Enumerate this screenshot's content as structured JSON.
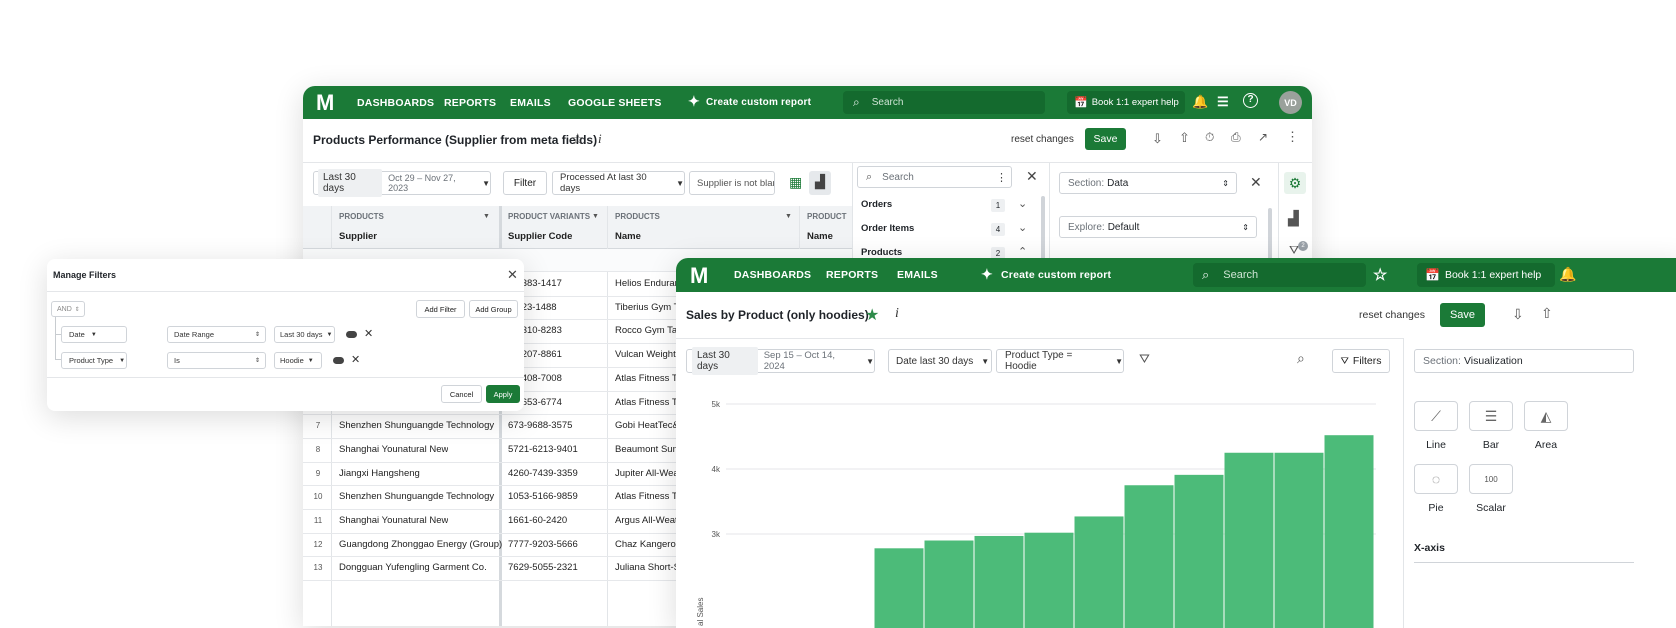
{
  "nav": {
    "dashboards": "DASHBOARDS",
    "reports": "REPORTS",
    "emails": "EMAILS",
    "google_sheets": "GOOGLE SHEETS",
    "create_custom_report": "Create custom report",
    "search_placeholder": "Search",
    "book_help": "Book 1:1 expert help",
    "avatar_initials": "VD"
  },
  "back": {
    "title": "Products Performance (Supplier from meta fields)",
    "reset": "reset changes",
    "save": "Save",
    "date_chip_label": "Last 30 days",
    "date_chip_range": "Oct 29 – Nov 27, 2023",
    "filter_btn": "Filter",
    "processed_chip": "Processed At last 30 days",
    "supplier_chip": "Supplier is not blan",
    "col_groups": [
      "PRODUCTS",
      "PRODUCT VARIANTS",
      "PRODUCTS",
      "PRODUCT"
    ],
    "col_headers": [
      "Supplier",
      "Supplier Code",
      "Name",
      "Name"
    ],
    "rows": [
      {
        "num": "",
        "supplier": "",
        "code": "1-8383-1417",
        "name": "Helios Enduran"
      },
      {
        "num": "",
        "supplier": "",
        "code": "7-423-1488",
        "name": "Tiberius Gym Ta"
      },
      {
        "num": "",
        "supplier": "",
        "code": "3-6310-8283",
        "name": "Rocco Gym Tan"
      },
      {
        "num": "",
        "supplier": "",
        "code": "7-4207-8861",
        "name": "Vulcan Weightli"
      },
      {
        "num": "",
        "supplier": "",
        "code": "7-8408-7008",
        "name": "Atlas Fitness Ta"
      },
      {
        "num": "",
        "supplier": "",
        "code": "8-3653-6774",
        "name": "Atlas Fitness Ta"
      },
      {
        "num": "7",
        "supplier": "Shenzhen Shunguangde Technology",
        "code": "673-9688-3575",
        "name": "Gobi HeatTec&"
      },
      {
        "num": "8",
        "supplier": "Shanghai Younatural New",
        "code": "5721-6213-9401",
        "name": "Beaumont Sum"
      },
      {
        "num": "9",
        "supplier": "Jiangxi Hangsheng",
        "code": "4260-7439-3359",
        "name": "Jupiter All-Wea"
      },
      {
        "num": "10",
        "supplier": "Shenzhen Shunguangde Technology",
        "code": "1053-5166-9859",
        "name": "Atlas Fitness Ta"
      },
      {
        "num": "11",
        "supplier": "Shanghai Younatural New",
        "code": "1661-60-2420",
        "name": "Argus All-Weath"
      },
      {
        "num": "12",
        "supplier": "Guangdong Zhonggao Energy (Group)",
        "code": "7777-9203-5666",
        "name": "Chaz Kangeroo"
      },
      {
        "num": "13",
        "supplier": "Dongguan Yufengling Garment Co.",
        "code": "7629-5055-2321",
        "name": "Juliana Short-S"
      }
    ],
    "field_search": "Search",
    "field_groups": [
      {
        "label": "Orders",
        "count": "1"
      },
      {
        "label": "Order Items",
        "count": "4"
      },
      {
        "label": "Products",
        "count": "2"
      }
    ],
    "section_label": "Section:",
    "section_value": "Data",
    "explore_label": "Explore:",
    "explore_value": "Default",
    "filter_badge": "2"
  },
  "filters": {
    "title": "Manage Filters",
    "and_label": "AND",
    "add_filter": "Add Filter",
    "add_group": "Add Group",
    "rows": [
      {
        "field": "Date",
        "op": "Date Range",
        "value": "Last 30 days"
      },
      {
        "field": "Product Type",
        "op": "Is",
        "value": "Hoodie"
      }
    ],
    "cancel": "Cancel",
    "apply": "Apply"
  },
  "front": {
    "nav_dashboards": "DASHBOARDS",
    "nav_reports": "REPORTS",
    "nav_emails": "EMAILS",
    "create_custom_report": "Create custom report",
    "search_placeholder": "Search",
    "book_help": "Book 1:1 expert help",
    "title": "Sales by Product (only hoodies)",
    "reset": "reset changes",
    "save": "Save",
    "date_chip_label": "Last 30 days",
    "date_chip_range": "Sep 15 – Oct 14, 2024",
    "date_filter_chip": "Date last 30 days",
    "product_type_chip": "Product Type = Hoodie",
    "filters_btn": "Filters",
    "section_label": "Section:",
    "section_value": "Visualization",
    "viz_types": [
      {
        "label": "Line",
        "icon": "line-chart-icon"
      },
      {
        "label": "Bar",
        "icon": "bar-chart-icon"
      },
      {
        "label": "Area",
        "icon": "area-chart-icon"
      },
      {
        "label": "Pie",
        "icon": "pie-chart-icon"
      },
      {
        "label": "Scalar",
        "icon": "scalar-icon",
        "glyph": "100"
      }
    ],
    "x_axis_heading": "X-axis"
  },
  "chart_data": {
    "type": "bar",
    "ylabel": "al Sales",
    "yticks": [
      3000,
      4000,
      5000
    ],
    "ytick_labels": [
      "3k",
      "4k",
      "5k"
    ],
    "ylim": [
      2380,
      5000
    ],
    "grid": true,
    "values": [
      2780,
      2900,
      2970,
      3020,
      3270,
      3750,
      3910,
      4250,
      4250,
      4520
    ]
  },
  "colors": {
    "brand_green": "#1b7a37",
    "bar_green": "#4cbb79",
    "star_green": "#2e8b4a"
  }
}
